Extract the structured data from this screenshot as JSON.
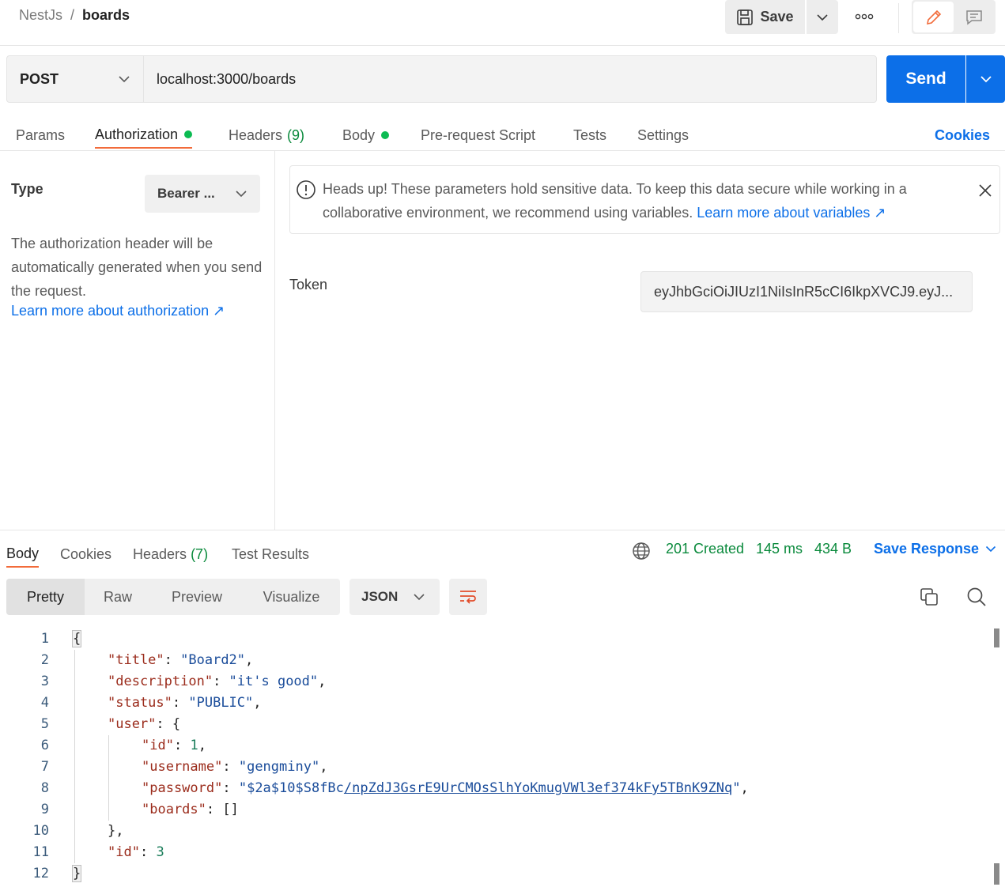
{
  "header": {
    "collection": "NestJs",
    "separator": "/",
    "request_name": "boards",
    "save_label": "Save"
  },
  "request": {
    "method": "POST",
    "url": "localhost:3000/boards",
    "send_label": "Send"
  },
  "req_tabs": {
    "params": "Params",
    "authorization": "Authorization",
    "headers": "Headers",
    "headers_count": "(9)",
    "body": "Body",
    "prerequest": "Pre-request Script",
    "tests": "Tests",
    "settings": "Settings",
    "cookies": "Cookies"
  },
  "auth": {
    "type_label": "Type",
    "type_value": "Bearer ...",
    "description": "The authorization header will be automatically generated when you send the request.",
    "learn_link": "Learn more about authorization ↗",
    "alert_text": "Heads up! These parameters hold sensitive data. To keep this data secure while working in a collaborative environment, we recommend using variables.",
    "alert_link": "Learn more about variables ↗",
    "token_label": "Token",
    "token_value": "eyJhbGciOiJIUzI1NiIsInR5cCI6IkpXVCJ9.eyJ..."
  },
  "response": {
    "tabs": {
      "body": "Body",
      "cookies": "Cookies",
      "headers": "Headers",
      "headers_count": "(7)",
      "tests": "Test Results"
    },
    "status": "201 Created",
    "time": "145 ms",
    "size": "434 B",
    "save_label": "Save Response",
    "views": {
      "pretty": "Pretty",
      "raw": "Raw",
      "preview": "Preview",
      "visualize": "Visualize"
    },
    "format": "JSON",
    "line_numbers": [
      "1",
      "2",
      "3",
      "4",
      "5",
      "6",
      "7",
      "8",
      "9",
      "10",
      "11",
      "12"
    ],
    "json": {
      "open": "{",
      "title_key": "\"title\"",
      "title_val": "\"Board2\"",
      "desc_key": "\"description\"",
      "desc_val": "\"it's good\"",
      "status_key": "\"status\"",
      "status_val": "\"PUBLIC\"",
      "user_key": "\"user\"",
      "id_key": "\"id\"",
      "id_val": "1",
      "username_key": "\"username\"",
      "username_val": "\"gengminy\"",
      "password_key": "\"password\"",
      "password_val_a": "\"$2a$10$S8fBc",
      "password_val_b": "/npZdJ3GsrE9UrCMOsSlhYoKmugVWl3ef374kFy5TBnK9ZNq",
      "password_val_c": "\"",
      "boards_key": "\"boards\"",
      "boards_val": "[]",
      "user_close": "},",
      "top_id_key": "\"id\"",
      "top_id_val": "3",
      "close": "}"
    }
  },
  "colors": {
    "accent": "#0c6fe8",
    "tab_underline": "#f26b3a",
    "status_green": "#0a8a3c",
    "dot_green": "#0cbb52"
  }
}
